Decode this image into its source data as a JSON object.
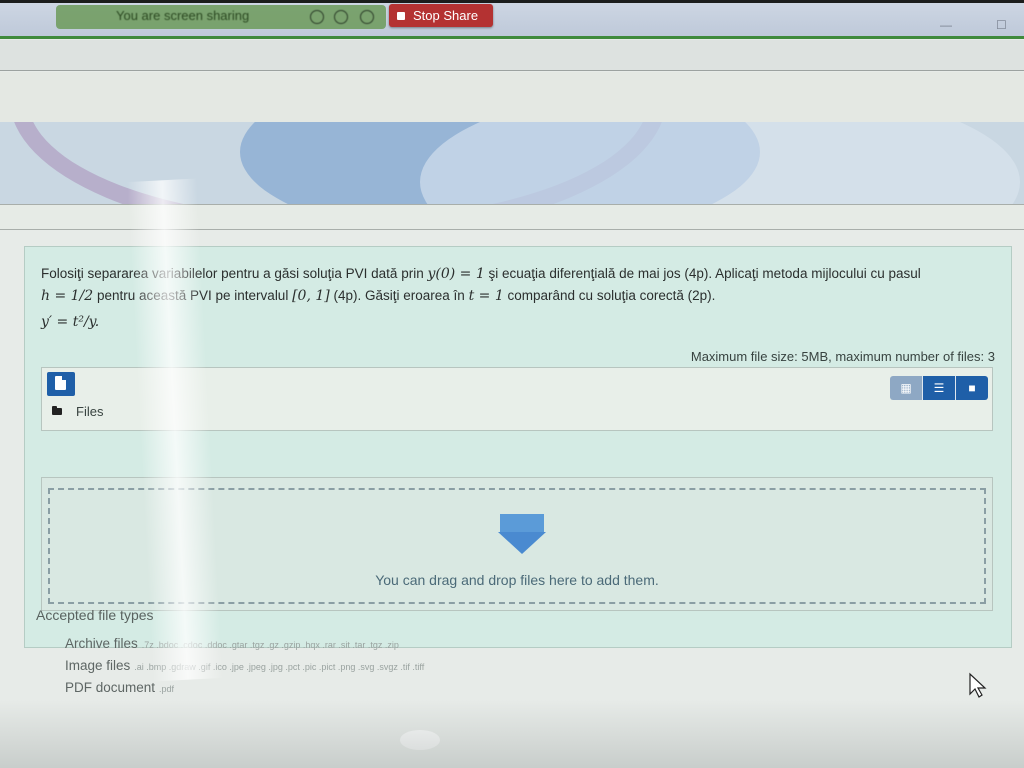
{
  "share_bar": {
    "sharing_text": "You are screen sharing",
    "stop_share_label": "Stop Share"
  },
  "question": {
    "line1_a": "Folosiţi separarea variabilelor pentru a găsi soluţia PVI dată prin",
    "line1_math_ic": "y(0) = 1",
    "line1_b": "şi ecuaţia diferenţială de mai jos (4p). Aplicaţi metoda mijlocului cu pasul",
    "line2_math_h": "h = 1/2",
    "line2_a": "pentru această PVI pe intervalul",
    "line2_math_interval": "[0, 1]",
    "line2_b": "(4p). Găsiţi eroarea în",
    "line2_math_t": "t = 1",
    "line2_c": "comparând cu soluţia corectă (2p).",
    "equation": "y′ = t²/y."
  },
  "filemanager": {
    "max_size_text": "Maximum file size: 5MB, maximum number of files: 3",
    "breadcrumb_label": "Files",
    "drop_text": "You can drag and drop files here to add them."
  },
  "accepted": {
    "heading": "Accepted file types",
    "types": [
      {
        "label": "Archive files",
        "exts": ".7z .bdoc .cdoc .ddoc .gtar .tgz .gz .gzip .hqx .rar .sit .tar .tgz .zip"
      },
      {
        "label": "Image files",
        "exts": ".ai .bmp .gdraw .gif .ico .jpe .jpeg .jpg .pct .pic .pict .png .svg .svgz .tif .tiff"
      },
      {
        "label": "PDF document",
        "exts": ".pdf"
      }
    ]
  },
  "colors": {
    "primary": "#1f5fa8",
    "stop_share": "#b43232",
    "card_bg": "#d4ebe4"
  }
}
